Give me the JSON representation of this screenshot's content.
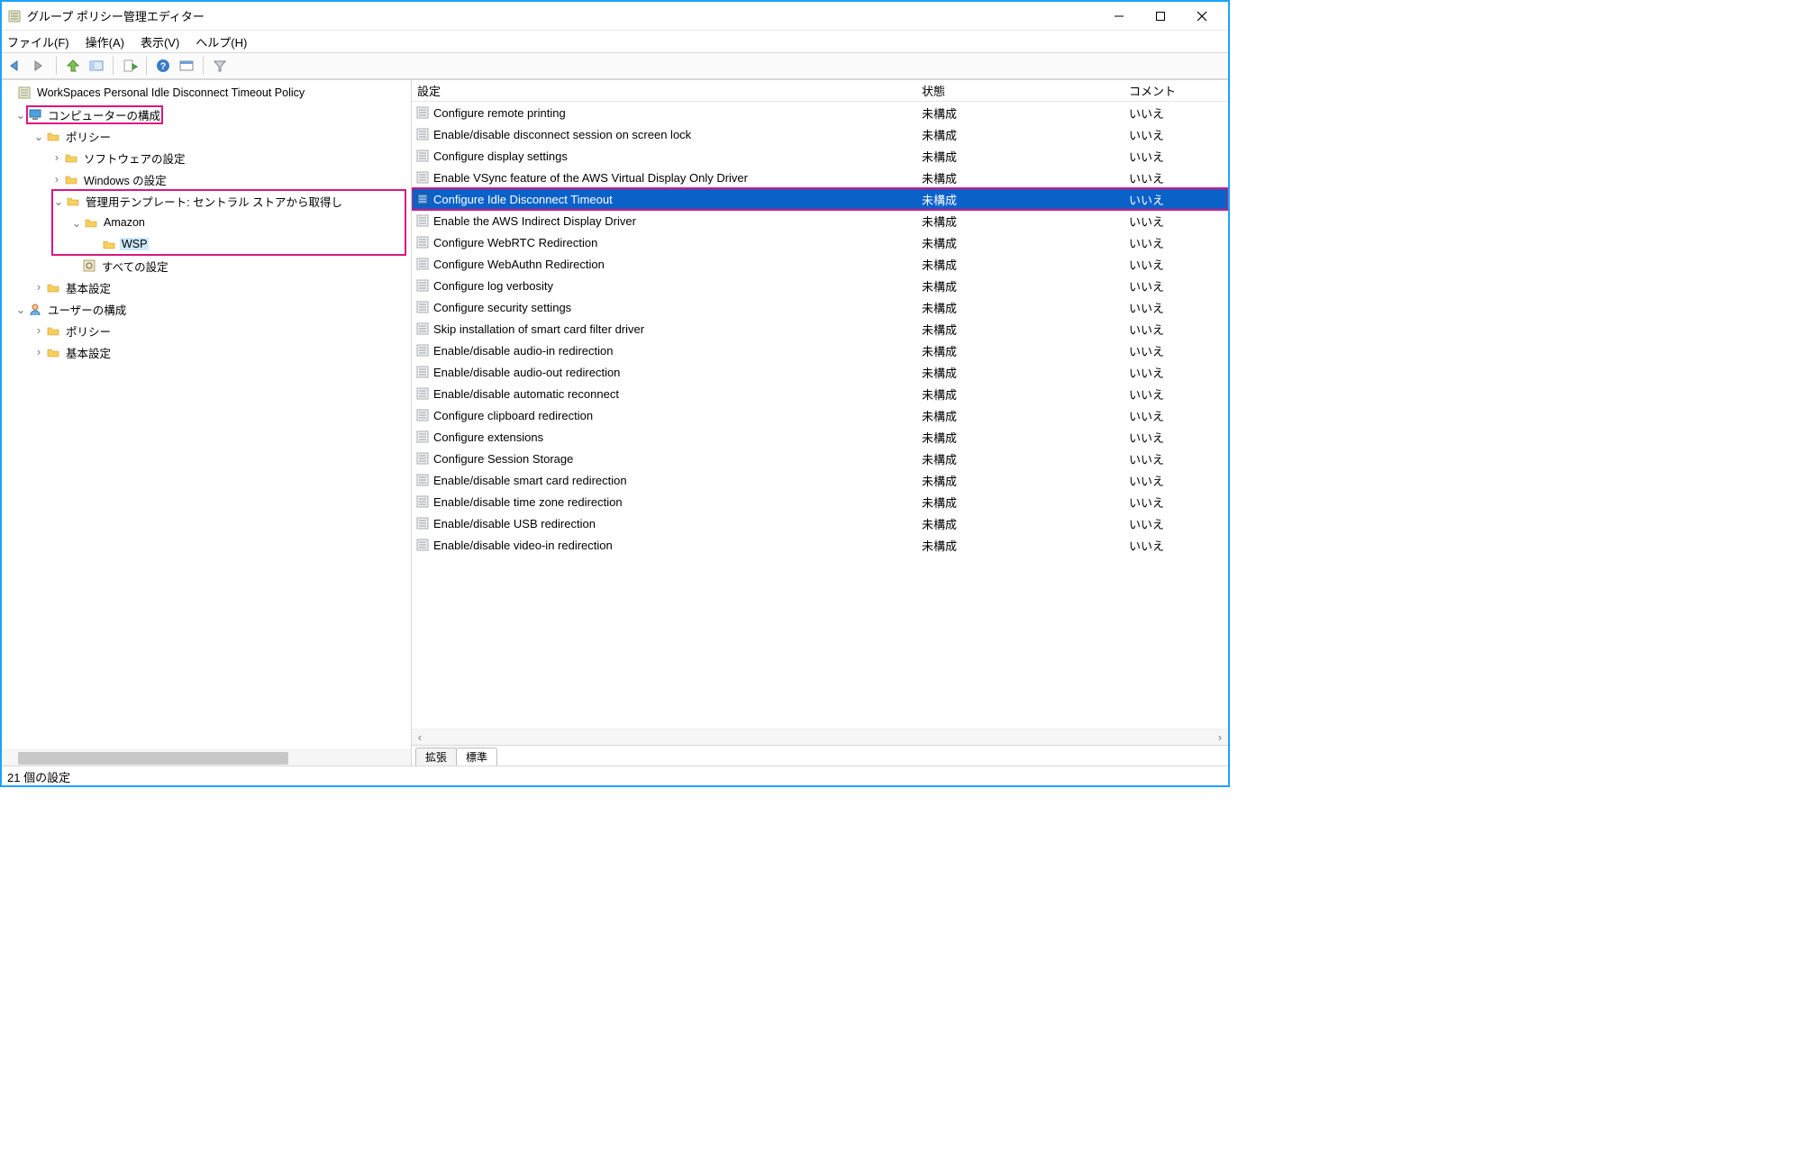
{
  "window": {
    "title": "グループ ポリシー管理エディター"
  },
  "menu": {
    "file": "ファイル(F)",
    "action": "操作(A)",
    "view": "表示(V)",
    "help": "ヘルプ(H)"
  },
  "tree": {
    "root": "WorkSpaces Personal Idle Disconnect Timeout Policy",
    "comp_config": "コンピューターの構成",
    "policy": "ポリシー",
    "software": "ソフトウェアの設定",
    "windows": "Windows の設定",
    "admin_tmpl": "管理用テンプレート: セントラル ストアから取得し",
    "amazon": "Amazon",
    "wsp": "WSP",
    "all_settings": "すべての設定",
    "basic": "基本設定",
    "user_config": "ユーザーの構成",
    "policy2": "ポリシー",
    "basic2": "基本設定"
  },
  "headers": {
    "setting": "設定",
    "state": "状態",
    "comment": "コメント"
  },
  "state_unconfigured": "未構成",
  "comment_no": "いいえ",
  "settings": [
    "Configure remote printing",
    "Enable/disable disconnect session on screen lock",
    "Configure display settings",
    "Enable VSync feature of the AWS Virtual Display Only Driver",
    "Configure Idle Disconnect Timeout",
    "Enable the AWS Indirect Display Driver",
    "Configure WebRTC Redirection",
    "Configure WebAuthn Redirection",
    "Configure log verbosity",
    "Configure security settings",
    "Skip installation of smart card filter driver",
    "Enable/disable audio-in redirection",
    "Enable/disable audio-out redirection",
    "Enable/disable automatic reconnect",
    "Configure clipboard redirection",
    "Configure extensions",
    "Configure Session Storage",
    "Enable/disable smart card redirection",
    "Enable/disable time zone redirection",
    "Enable/disable USB redirection",
    "Enable/disable video-in redirection"
  ],
  "selected_index": 4,
  "tabs": {
    "extended": "拡張",
    "standard": "標準"
  },
  "status": "21 個の設定"
}
